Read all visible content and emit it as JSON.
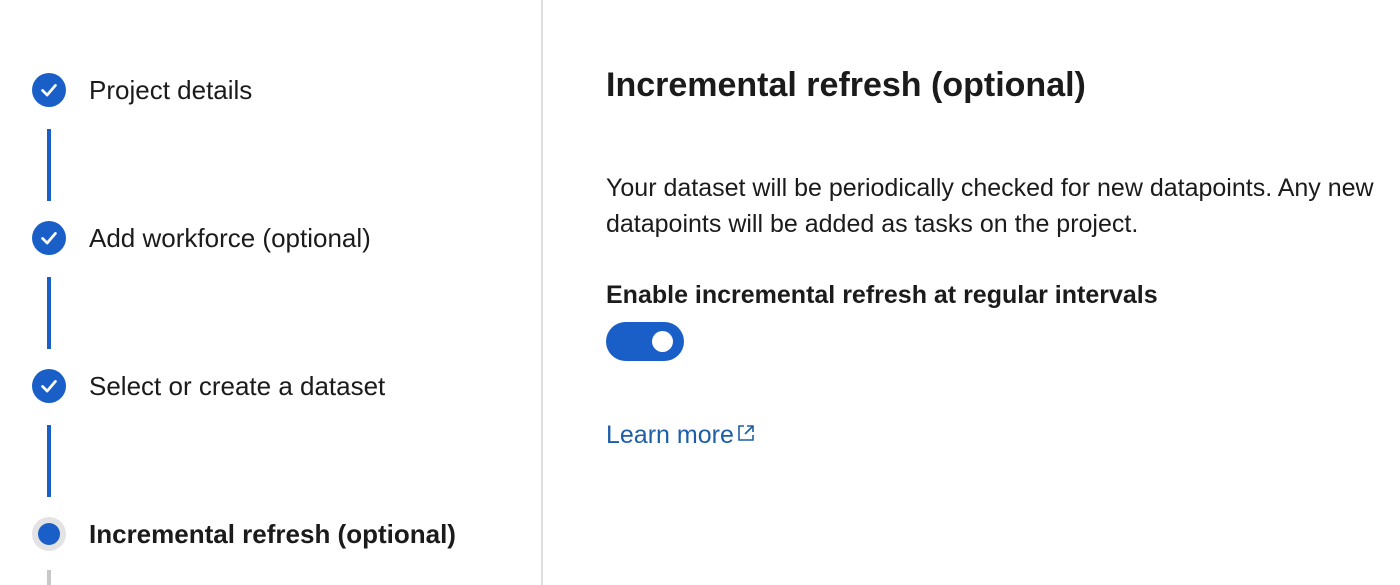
{
  "stepper": {
    "steps": [
      {
        "label": "Project details",
        "state": "completed"
      },
      {
        "label": "Add workforce (optional)",
        "state": "completed"
      },
      {
        "label": "Select or create a dataset",
        "state": "completed"
      },
      {
        "label": "Incremental refresh (optional)",
        "state": "current"
      }
    ]
  },
  "content": {
    "title": "Incremental refresh (optional)",
    "description": "Your dataset will be periodically checked for new datapoints. Any new datapoints will be added as tasks on the project.",
    "toggle_label": "Enable incremental refresh at regular intervals",
    "toggle_on": true,
    "learn_more": "Learn more"
  },
  "colors": {
    "accent": "#1a5fc8",
    "link": "#1d5ea8",
    "divider": "#dedede"
  },
  "icons": [
    "checkmark-icon",
    "external-link-icon"
  ]
}
